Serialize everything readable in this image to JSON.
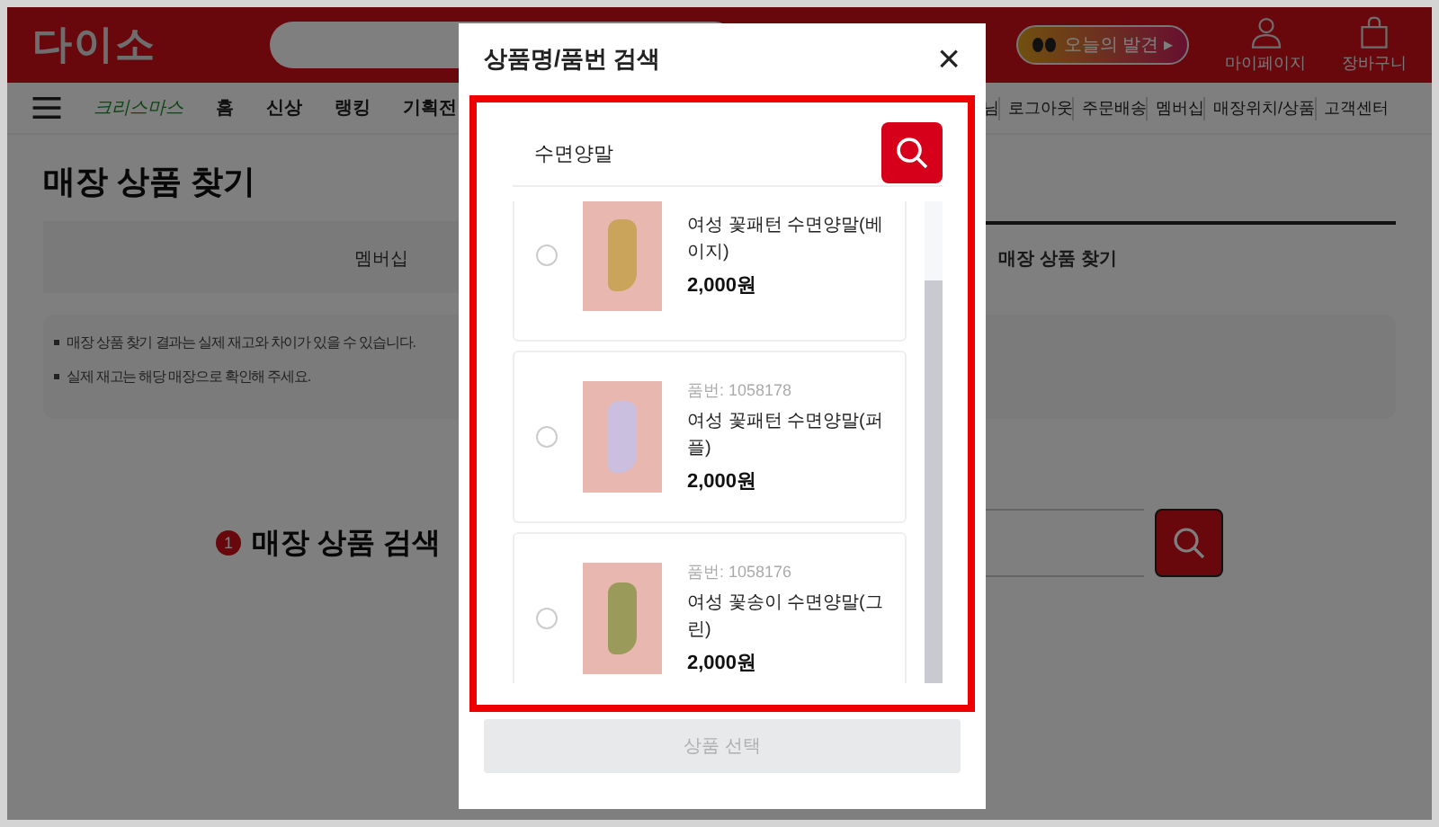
{
  "header": {
    "logo": "다이소",
    "promo": "오늘의 발견 ▸",
    "account": "마이페이지",
    "cart": "장바구니"
  },
  "nav": {
    "event": "크리스마스",
    "left": [
      "홈",
      "신상",
      "랭킹",
      "기획전"
    ],
    "right": [
      "님",
      "로그아웃",
      "주문배송",
      "멤버십",
      "매장위치/상품",
      "고객센터"
    ]
  },
  "page": {
    "title": "매장 상품 찾기",
    "tabs": [
      {
        "label": "멤버십",
        "selected": false
      },
      {
        "label": "매장 상품 찾기",
        "selected": true
      }
    ],
    "notices": [
      "매장 상품 찾기 결과는 실제 재고와 차이가 있을 수 있습니다.",
      "실제 재고는 해당 매장으로 확인해 주세요."
    ],
    "section": {
      "step": "1",
      "title": "매장 상품 검색"
    }
  },
  "modal": {
    "title": "상품명/품번 검색",
    "close": "×",
    "search": {
      "value": "수면양말"
    },
    "items": [
      {
        "name": "여성 꽃패턴 수면양말(베이지)",
        "price": "2,000원",
        "selected": false,
        "color": "#c9a45a"
      },
      {
        "code": "품번: 1058178",
        "name": "여성 꽃패턴 수면양말(퍼플)",
        "price": "2,000원",
        "selected": false,
        "color": "#cbbfe0"
      },
      {
        "code": "품번: 1058176",
        "name": "여성 꽃송이 수면양말(그린)",
        "price": "2,000원",
        "selected": false,
        "color": "#9a9a5a"
      }
    ],
    "submit": {
      "label": "상품 선택",
      "disabled": true
    }
  }
}
